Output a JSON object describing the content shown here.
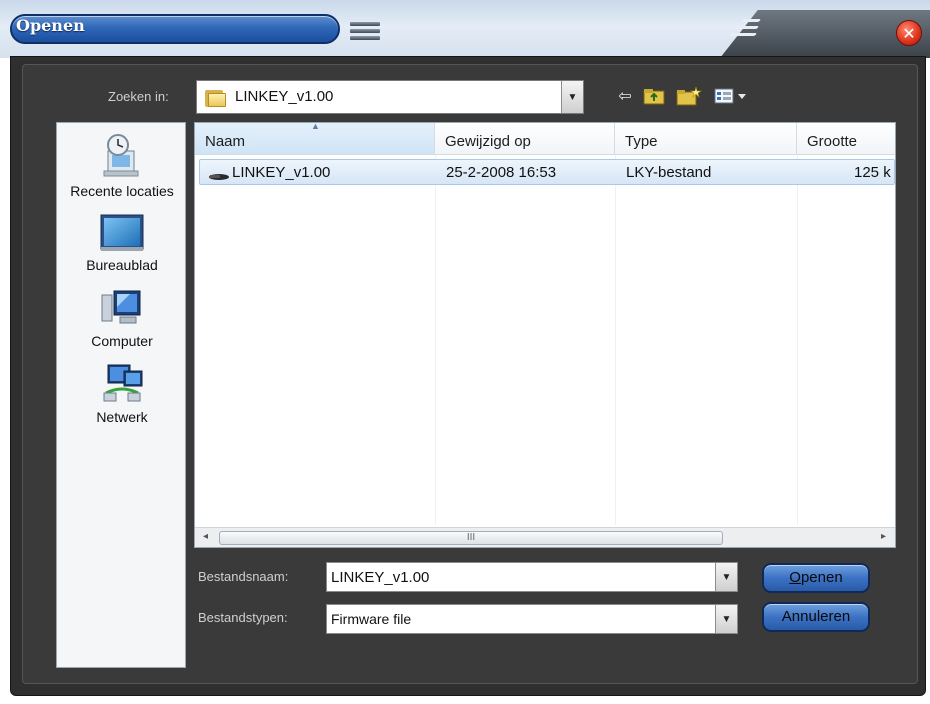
{
  "window": {
    "title": "Openen",
    "close_symbol": "✕"
  },
  "lookin": {
    "label": "Zoeken in:",
    "value": "LINKEY_v1.00",
    "icons": [
      "folder-icon",
      "back-arrow-icon",
      "up-folder-icon",
      "new-folder-icon",
      "view-menu-icon"
    ]
  },
  "places": [
    {
      "label": "Recente locaties",
      "icon": "recent-locations-icon"
    },
    {
      "label": "Bureaublad",
      "icon": "desktop-icon"
    },
    {
      "label": "Computer",
      "icon": "computer-icon"
    },
    {
      "label": "Netwerk",
      "icon": "network-icon"
    }
  ],
  "file_list": {
    "columns": [
      "Naam",
      "Gewijzigd op",
      "Type",
      "Grootte"
    ],
    "sort_column": "Naam",
    "rows": [
      {
        "name": "LINKEY_v1.00",
        "modified": "25-2-2008 16:53",
        "type": "LKY-bestand",
        "size": "125 k"
      }
    ],
    "scrollbar": {
      "left_arrow": "◂",
      "right_arrow": "▸",
      "grip": "III"
    }
  },
  "filename": {
    "label": "Bestandsnaam:",
    "value": "LINKEY_v1.00"
  },
  "filetype": {
    "label": "Bestandstypen:",
    "value": "Firmware file"
  },
  "buttons": {
    "open_label": "Openen",
    "open_mnemonic": "O",
    "open_rest": "penen",
    "cancel_label": "Annuleren"
  },
  "colors": {
    "title_blue": "#2f67b8",
    "frame_dark": "#2f2f2f",
    "selection": "#d6e6f6"
  }
}
